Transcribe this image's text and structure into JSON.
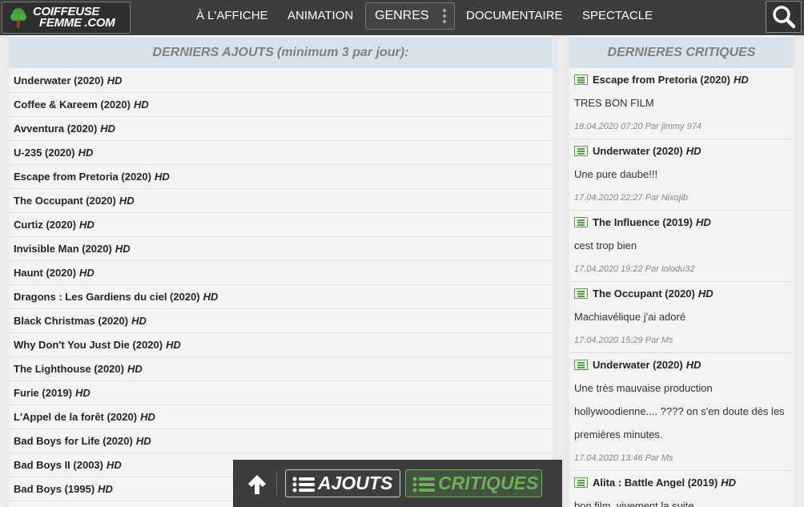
{
  "header": {
    "logo_line1": "COIFFEUSE",
    "logo_line2": "FEMME .COM",
    "nav": [
      {
        "label": "À L'AFFICHE"
      },
      {
        "label": "ANIMATION"
      },
      {
        "label": "GENRES"
      },
      {
        "label": "DOCUMENTAIRE"
      },
      {
        "label": "SPECTACLE"
      }
    ],
    "search_icon": "search-icon"
  },
  "ajouts": {
    "title": "DERNIERS AJOUTS",
    "subtitle": "(minimum 3 par jour):",
    "items": [
      {
        "title": "Underwater (2020)",
        "badge": "HD"
      },
      {
        "title": "Coffee & Kareem (2020)",
        "badge": "HD"
      },
      {
        "title": "Avventura (2020)",
        "badge": "HD"
      },
      {
        "title": "U-235 (2020)",
        "badge": "HD"
      },
      {
        "title": "Escape from Pretoria (2020)",
        "badge": "HD"
      },
      {
        "title": "The Occupant (2020)",
        "badge": "HD"
      },
      {
        "title": "Curtiz (2020)",
        "badge": "HD"
      },
      {
        "title": "Invisible Man (2020)",
        "badge": "HD"
      },
      {
        "title": "Haunt (2020)",
        "badge": "HD"
      },
      {
        "title": "Dragons : Les Gardiens du ciel (2020)",
        "badge": "HD"
      },
      {
        "title": "Black Christmas (2020)",
        "badge": "HD"
      },
      {
        "title": "Why Don't You Just Die (2020)",
        "badge": "HD"
      },
      {
        "title": "The Lighthouse (2020)",
        "badge": "HD"
      },
      {
        "title": "Furie (2019)",
        "badge": "HD"
      },
      {
        "title": "L'Appel de la forêt (2020)",
        "badge": "HD"
      },
      {
        "title": "Bad Boys for Life (2020)",
        "badge": "HD"
      },
      {
        "title": "Bad Boys II (2003)",
        "badge": "HD"
      },
      {
        "title": "Bad Boys (1995)",
        "badge": "HD"
      }
    ]
  },
  "critiques": {
    "title_a": "DERNIERES",
    "title_b": "CRITIQUES",
    "items": [
      {
        "title": "Escape from Pretoria (2020)",
        "badge": "HD",
        "text": "TRES BON FILM",
        "meta": "18.04.2020 07:20 Par jimmy 974"
      },
      {
        "title": "Underwater (2020)",
        "badge": "HD",
        "text": "Une pure daube!!!",
        "meta": "17.04.2020 22:27 Par Nixojib"
      },
      {
        "title": "The Influence (2019)",
        "badge": "HD",
        "text": "cest trop bien",
        "meta": "17.04.2020 19:22 Par lolodu32"
      },
      {
        "title": "The Occupant (2020)",
        "badge": "HD",
        "text": "Machiavélique j'ai adoré",
        "meta": "17.04.2020 15:29 Par Ms"
      },
      {
        "title": "Underwater (2020)",
        "badge": "HD",
        "text": "Une très mauvaise production hollywoodienne.... ???? on s'en doute dès les premières minutes.",
        "meta": "17.04.2020 13:46 Par Ms"
      },
      {
        "title": "Alita : Battle Angel (2019)",
        "badge": "HD",
        "text": "bon film, vivement la suite",
        "meta": ""
      }
    ]
  },
  "bottom": {
    "up_icon": "arrow-up-icon",
    "ajouts_label": "AJOUTS",
    "critiques_label": "CRITIQUES"
  },
  "colors": {
    "topbar": "#3d3d3d",
    "panel_header": "#d6e3ec",
    "accent_green": "#6ab15a"
  }
}
